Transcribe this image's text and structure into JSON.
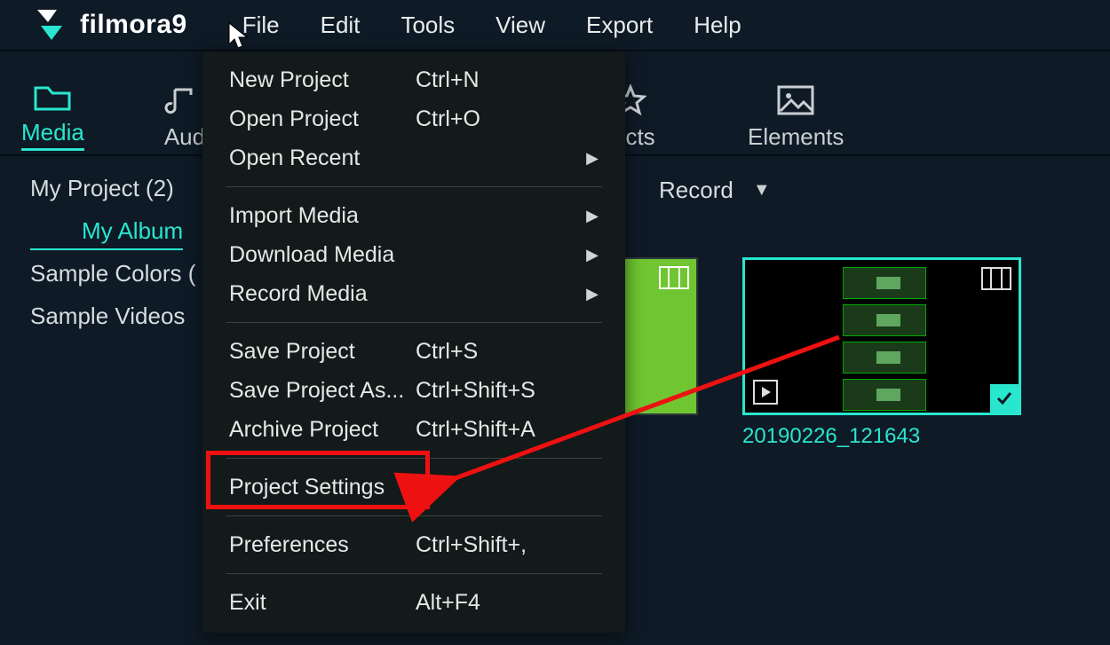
{
  "app": {
    "name": "filmora9"
  },
  "menubar": [
    "File",
    "Edit",
    "Tools",
    "View",
    "Export",
    "Help"
  ],
  "tabs": {
    "media": "Media",
    "audio_clipped": "Aud",
    "effects_clipped": "ects",
    "elements": "Elements"
  },
  "sidebar": {
    "my_project": "My Project (2)",
    "my_album": "My Album",
    "sample_colors": "Sample Colors (",
    "sample_videos": "Sample Videos"
  },
  "file_menu": {
    "new_project": {
      "label": "New Project",
      "shortcut": "Ctrl+N"
    },
    "open_project": {
      "label": "Open Project",
      "shortcut": "Ctrl+O"
    },
    "open_recent": {
      "label": "Open Recent"
    },
    "import_media": {
      "label": "Import Media"
    },
    "download_media": {
      "label": "Download Media"
    },
    "record_media": {
      "label": "Record Media"
    },
    "save_project": {
      "label": "Save Project",
      "shortcut": "Ctrl+S"
    },
    "save_project_as": {
      "label": "Save Project As...",
      "shortcut": "Ctrl+Shift+S"
    },
    "archive_project": {
      "label": "Archive Project",
      "shortcut": "Ctrl+Shift+A"
    },
    "project_settings": {
      "label": "Project Settings"
    },
    "preferences": {
      "label": "Preferences",
      "shortcut": "Ctrl+Shift+,"
    },
    "exit": {
      "label": "Exit",
      "shortcut": "Alt+F4"
    }
  },
  "content": {
    "record_label": "Record",
    "thumb2_caption": "20190226_121643"
  }
}
